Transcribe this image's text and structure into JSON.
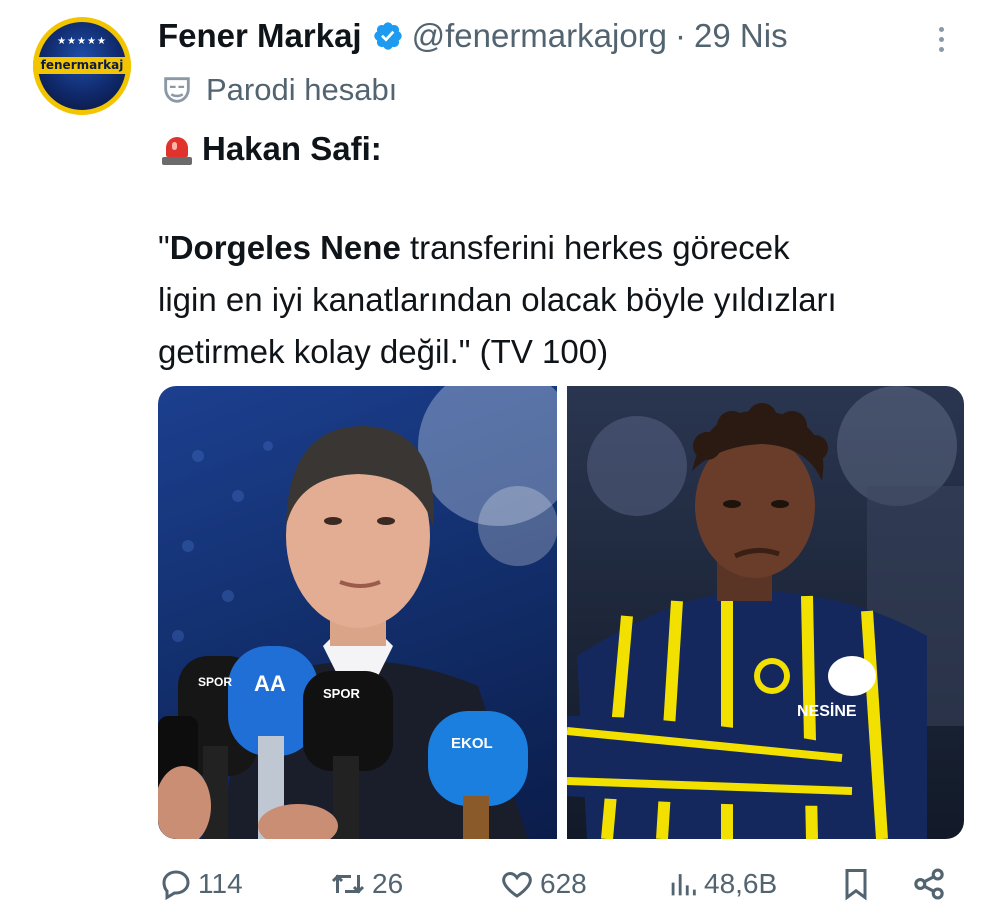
{
  "account": {
    "avatar_text": "fenermarkaj",
    "display_name": "Fener Markaj",
    "handle": "@fenermarkajorg",
    "separator": "·",
    "date": "29 Nis",
    "label": "Parodi hesabı"
  },
  "post": {
    "alert_title": "Hakan Safi:",
    "quote_line1_open": "\"",
    "quote_line1_bold": "Dorgeles Nene",
    "quote_line1_rest": " transferini herkes görecek",
    "quote_line2": "ligin en iyi kanatlarından olacak böyle yıldızları",
    "quote_line3": "getirmek kolay değil.\" (TV 100)"
  },
  "media": {
    "left_mic_labels": [
      "SPOR",
      "AA",
      "SPOR",
      "EKOL"
    ],
    "right_shirt_text": "NESİNE"
  },
  "actions": {
    "replies": "114",
    "reposts": "26",
    "likes": "628",
    "views": "48,6B"
  },
  "colors": {
    "accent": "#1d9bf0",
    "muted": "#536471",
    "text": "#0f1419",
    "fener_yellow": "#f3c400",
    "fener_navy": "#0a1b4d"
  },
  "icons": [
    "verified-badge-icon",
    "more-options-icon",
    "parody-mask-icon",
    "siren-icon",
    "reply-icon",
    "repost-icon",
    "like-icon",
    "views-icon",
    "bookmark-icon",
    "share-icon"
  ]
}
